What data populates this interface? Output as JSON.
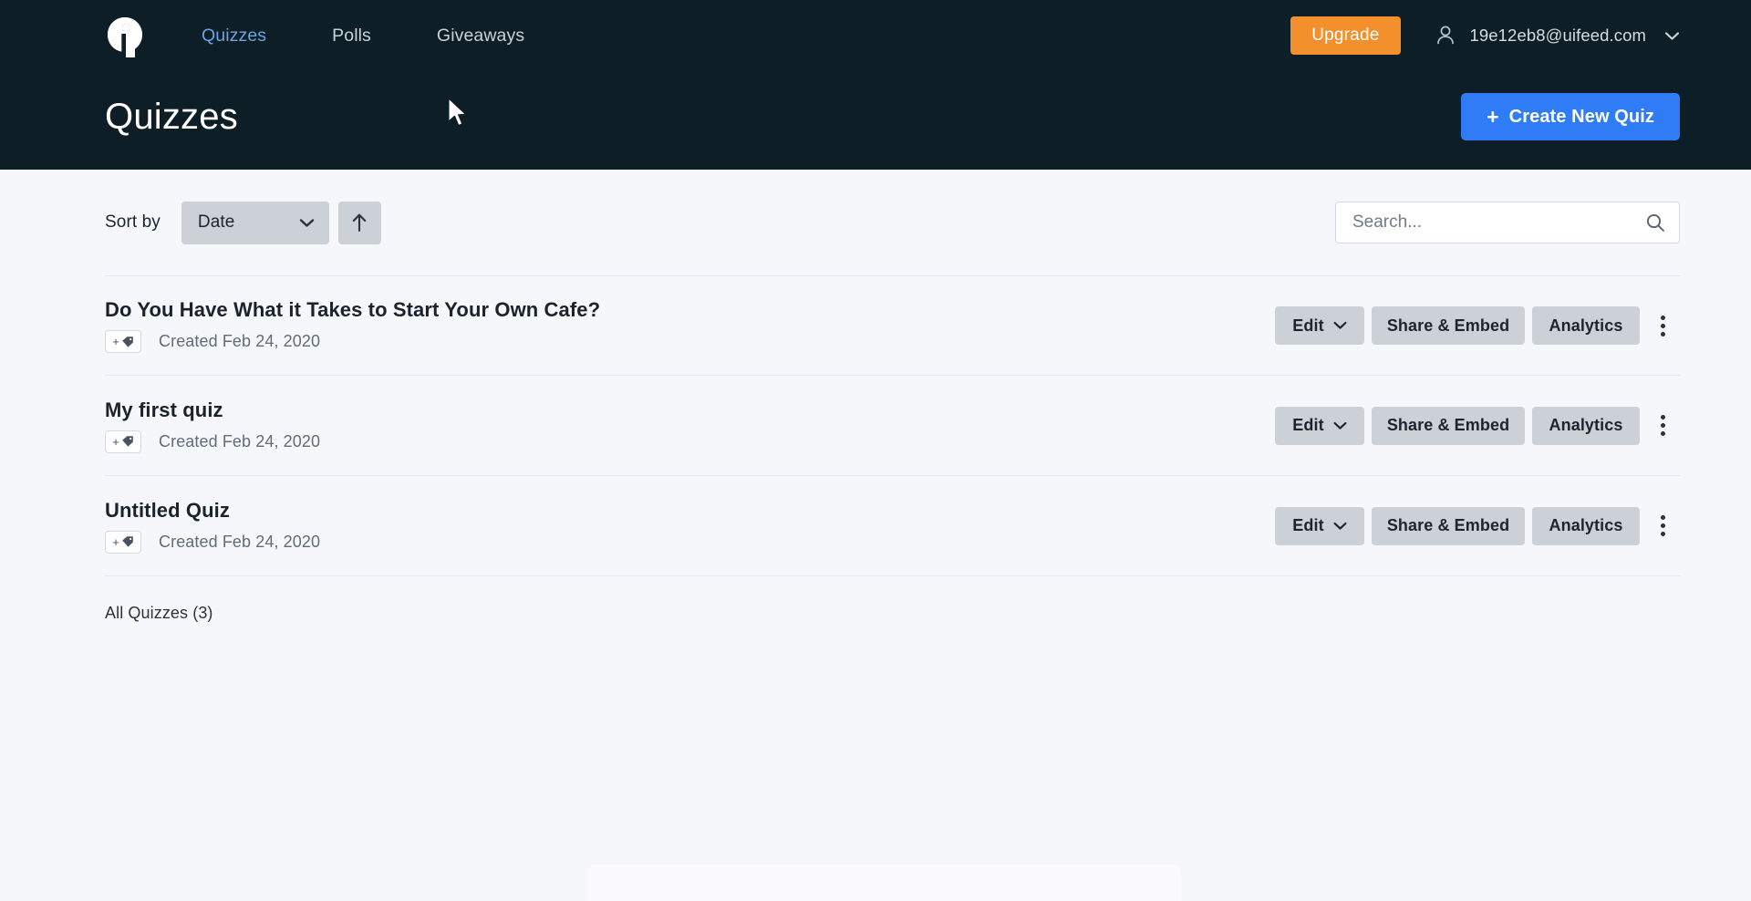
{
  "brand": {
    "logo_icon": "info-circle-logo",
    "accent_blue": "#2f7cf6",
    "accent_orange": "#f4902b",
    "header_bg": "#0e1e26",
    "page_bg": "#f6f7fb"
  },
  "nav": {
    "items": [
      {
        "label": "Quizzes",
        "active": true
      },
      {
        "label": "Polls",
        "active": false
      },
      {
        "label": "Giveaways",
        "active": false
      }
    ],
    "upgrade_label": "Upgrade",
    "user_email": "19e12eb8@uifeed.com",
    "user_icon": "user-icon",
    "caret_icon": "chevron-down-icon"
  },
  "header": {
    "title": "Quizzes",
    "create_button": {
      "plus": "+",
      "label": "Create New Quiz"
    }
  },
  "toolbar": {
    "sort_label": "Sort by",
    "sort_value": "Date",
    "sort_options": [
      "Date"
    ],
    "sort_direction_icon": "arrow-up-icon",
    "search_placeholder": "Search...",
    "search_value": "",
    "search_icon": "search-icon"
  },
  "actions": {
    "edit_label": "Edit",
    "share_label": "Share & Embed",
    "analytics_label": "Analytics",
    "tag_plus": "+",
    "tag_icon": "tag-icon",
    "kebab_icon": "more-vertical-icon"
  },
  "quizzes": [
    {
      "title": "Do You Have What it Takes to Start Your Own Cafe?",
      "created": "Created Feb 24, 2020"
    },
    {
      "title": "My first quiz",
      "created": "Created Feb 24, 2020"
    },
    {
      "title": "Untitled Quiz",
      "created": "Created Feb 24, 2020"
    }
  ],
  "footer": {
    "all_quizzes_label": "All Quizzes (3)"
  }
}
